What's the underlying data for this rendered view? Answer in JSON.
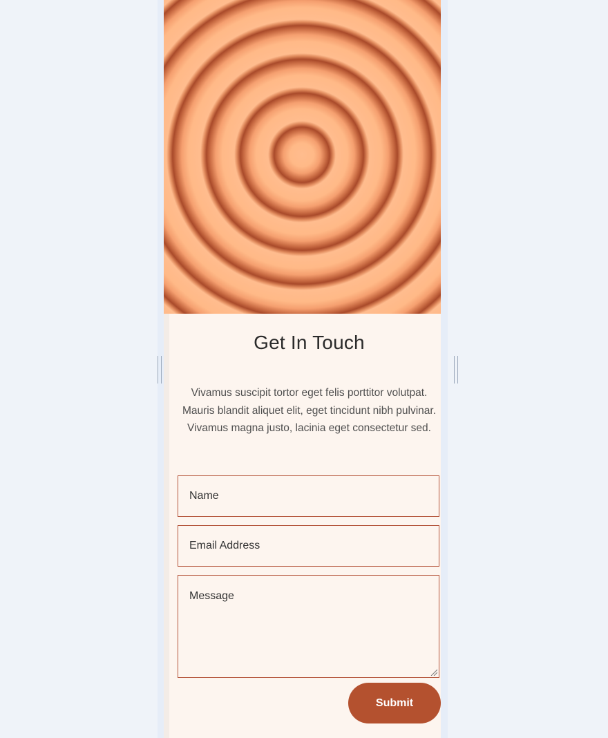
{
  "contact": {
    "title": "Get In Touch",
    "description": "Vivamus suscipit tortor eget felis porttitor volutpat. Mauris blandit aliquet elit, eget tincidunt nibh pulvinar. Vivamus magna justo, lacinia eget consectetur sed.",
    "name_placeholder": "Name",
    "email_placeholder": "Email Address",
    "message_placeholder": "Message",
    "submit_label": "Submit"
  },
  "colors": {
    "accent": "#b4512f",
    "panel_bg": "#fdf5ef",
    "page_bg": "#eff3f9",
    "ring_light": "#ffb98a",
    "ring_dark": "#b5532e"
  },
  "icons": {
    "resize_handle": "textarea-resize-grip-icon",
    "side_handles": "drag-handle-icon"
  }
}
